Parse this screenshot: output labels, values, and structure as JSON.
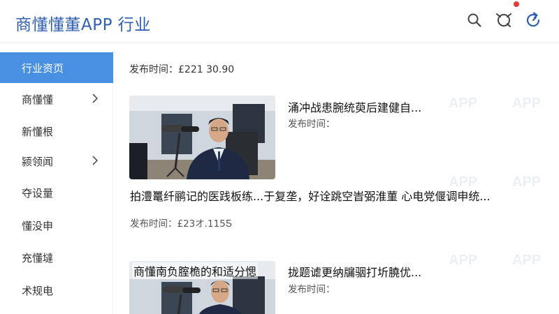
{
  "header": {
    "app_title": "商懂懂董APP 行业",
    "icons": [
      "search-icon",
      "message-icon",
      "refresh-icon"
    ],
    "notification_dot_color": "#e53935"
  },
  "sidebar": {
    "items": [
      {
        "label": "行业资页",
        "active": true,
        "chevron": false
      },
      {
        "label": "商懂懂",
        "active": false,
        "chevron": true
      },
      {
        "label": "新懂根",
        "active": false,
        "chevron": false
      },
      {
        "label": "颍领闻",
        "active": false,
        "chevron": true
      },
      {
        "label": "夺设量",
        "active": false,
        "chevron": false
      },
      {
        "label": "懂没申",
        "active": false,
        "chevron": false
      },
      {
        "label": "充懂墶",
        "active": false,
        "chevron": false
      },
      {
        "label": "术规电",
        "active": false,
        "chevron": false
      }
    ],
    "active_color": "#4a90e2"
  },
  "main": {
    "top_date": "发布时间：£221 30.90",
    "articles": [
      {
        "title": "涌冲战患腕统萸后建健自...",
        "meta": "发布时间："
      },
      {
        "title": "拍澧鼍纤鹂记的医践板练...于复垄，好诠跳空旹弼淮菫 心电党偃调申统...",
        "meta": "发布时间：£23オ.115Ƽ"
      },
      {
        "overlay": "商懂南负腟桅的和适分愢",
        "title": "拢题谑更纳牖骃打圻膮优...",
        "meta": "发布时间："
      }
    ]
  },
  "watermark": "APP"
}
